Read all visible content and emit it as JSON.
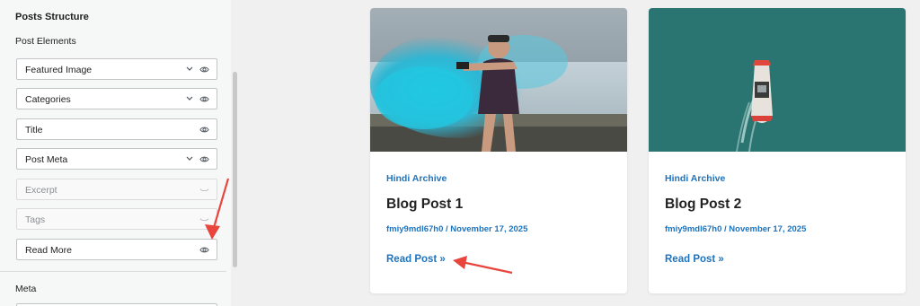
{
  "panel": {
    "section_title": "Posts Structure",
    "sub_title": "Post Elements",
    "items": [
      {
        "label": "Featured Image",
        "has_dropdown": true,
        "visible": true
      },
      {
        "label": "Categories",
        "has_dropdown": true,
        "visible": true
      },
      {
        "label": "Title",
        "has_dropdown": false,
        "visible": true
      },
      {
        "label": "Post Meta",
        "has_dropdown": true,
        "visible": true
      },
      {
        "label": "Excerpt",
        "has_dropdown": false,
        "visible": false
      },
      {
        "label": "Tags",
        "has_dropdown": false,
        "visible": false
      },
      {
        "label": "Read More",
        "has_dropdown": false,
        "visible": true
      }
    ],
    "meta_title": "Meta"
  },
  "posts": [
    {
      "category": "Hindi Archive",
      "title": "Blog Post 1",
      "meta": "fmiy9mdl67h0 / November 17, 2025",
      "read_more": "Read Post »"
    },
    {
      "category": "Hindi Archive",
      "title": "Blog Post 2",
      "meta": "fmiy9mdl67h0 / November 17, 2025",
      "read_more": "Read Post »"
    }
  ],
  "colors": {
    "accent": "#1e73be",
    "annotation": "#e8453c"
  }
}
